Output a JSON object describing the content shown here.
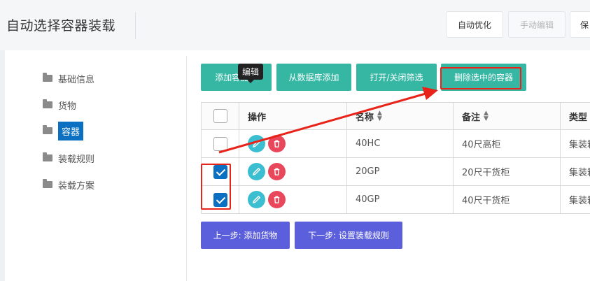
{
  "header": {
    "title": "自动选择容器装载",
    "buttons": {
      "auto_optimize": "自动优化",
      "manual_edit": "手动编辑",
      "save": "保"
    }
  },
  "sidebar": {
    "items": [
      {
        "label": "基础信息",
        "icon": "folder-icon",
        "active": false
      },
      {
        "label": "货物",
        "icon": "folder-icon",
        "active": false
      },
      {
        "label": "容器",
        "icon": "folder-icon",
        "active": true
      },
      {
        "label": "装载规则",
        "icon": "folder-icon",
        "active": false
      },
      {
        "label": "装载方案",
        "icon": "folder-icon",
        "active": false
      }
    ]
  },
  "toolbar": {
    "add_container": "添加容器",
    "add_from_db": "从数据库添加",
    "toggle_filter": "打开/关闭筛选",
    "delete_selected": "删除选中的容器"
  },
  "table": {
    "headers": {
      "action": "操作",
      "name": "名称",
      "note": "备注",
      "type": "类型"
    },
    "tooltip": "编辑",
    "rows": [
      {
        "checked": false,
        "name": "40HC",
        "note": "40尺高柜",
        "type": "集装箱"
      },
      {
        "checked": true,
        "name": "20GP",
        "note": "20尺干货柜",
        "type": "集装箱"
      },
      {
        "checked": true,
        "name": "40GP",
        "note": "40尺干货柜",
        "type": "集装箱"
      }
    ]
  },
  "footer": {
    "prev_step": "上一步: 添加货物",
    "next_step": "下一步: 设置装载规则"
  },
  "colors": {
    "teal_button": "#35b7a4",
    "purple_button": "#5b5fdc",
    "active_blue": "#0b6fc2",
    "edit_icon": "#3bbfd0",
    "delete_icon": "#e9485c",
    "annotation_red": "#e8231a"
  }
}
